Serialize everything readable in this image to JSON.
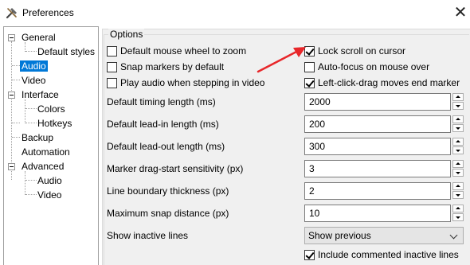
{
  "window": {
    "title": "Preferences",
    "close_glyph": "✕",
    "icon": "wrench-hammer-icon"
  },
  "tree": {
    "general": "General",
    "default_styles": "Default styles",
    "audio": "Audio",
    "video": "Video",
    "interface": "Interface",
    "colors": "Colors",
    "hotkeys": "Hotkeys",
    "backup": "Backup",
    "automation": "Automation",
    "advanced": "Advanced",
    "adv_audio": "Audio",
    "adv_video": "Video",
    "selected": "Audio"
  },
  "options": {
    "title": "Options",
    "checkboxes": {
      "wheel_zoom": {
        "label": "Default mouse wheel to zoom",
        "checked": false
      },
      "lock_scroll": {
        "label": "Lock scroll on cursor",
        "checked": true
      },
      "snap_markers": {
        "label": "Snap markers by default",
        "checked": false
      },
      "auto_focus": {
        "label": "Auto-focus on mouse over",
        "checked": false
      },
      "play_audio": {
        "label": "Play audio when stepping in video",
        "checked": false
      },
      "left_click_drag": {
        "label": "Left-click-drag moves end marker",
        "checked": true
      },
      "include_commented": {
        "label": "Include commented inactive lines",
        "checked": true
      }
    },
    "fields": {
      "timing_length": {
        "label": "Default timing length (ms)",
        "value": "2000"
      },
      "lead_in": {
        "label": "Default lead-in length (ms)",
        "value": "200"
      },
      "lead_out": {
        "label": "Default lead-out length (ms)",
        "value": "300"
      },
      "drag_sensitivity": {
        "label": "Marker drag-start sensitivity (px)",
        "value": "3"
      },
      "line_boundary": {
        "label": "Line boundary thickness (px)",
        "value": "2"
      },
      "max_snap": {
        "label": "Maximum snap distance (px)",
        "value": "10"
      }
    },
    "inactive_lines": {
      "label": "Show inactive lines",
      "value": "Show previous"
    }
  },
  "annotation": {
    "color": "#e8272a"
  }
}
